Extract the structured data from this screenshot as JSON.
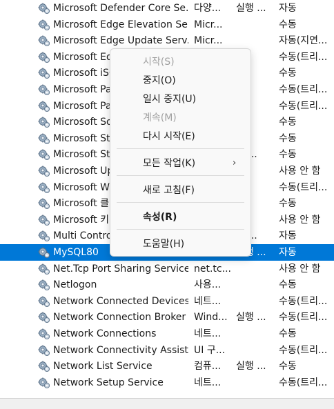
{
  "services": [
    {
      "name": "Microsoft Defender Core Se...",
      "desc": "다양...",
      "status": "실행 ...",
      "start": "자동"
    },
    {
      "name": "Microsoft Edge Elevation Se...",
      "desc": "Micr...",
      "status": "",
      "start": "수동"
    },
    {
      "name": "Microsoft Edge Update Serv...",
      "desc": "Micr...",
      "status": "",
      "start": "자동(지연..."
    },
    {
      "name": "Microsoft Ed",
      "desc": "",
      "status": "",
      "start": "수동(트리..."
    },
    {
      "name": "Microsoft iSC",
      "desc": "",
      "status": "",
      "start": "수동"
    },
    {
      "name": "Microsoft Pa",
      "desc": "",
      "status": "",
      "start": "수동(트리..."
    },
    {
      "name": "Microsoft Pa",
      "desc": "",
      "status": "",
      "start": "수동(트리..."
    },
    {
      "name": "Microsoft So",
      "desc": "",
      "status": "",
      "start": "수동"
    },
    {
      "name": "Microsoft Sto",
      "desc": "",
      "status": "",
      "start": "수동"
    },
    {
      "name": "Microsoft Sto",
      "desc": "",
      "status": "행 ...",
      "start": "수동"
    },
    {
      "name": "Microsoft Up",
      "desc": "",
      "status": "",
      "start": "사용 안 함"
    },
    {
      "name": "Microsoft Wi",
      "desc": "",
      "status": "",
      "start": "수동(트리..."
    },
    {
      "name": "Microsoft 클",
      "desc": "",
      "status": "",
      "start": "수동"
    },
    {
      "name": "Microsoft 키",
      "desc": "",
      "status": "",
      "start": "사용 안 함"
    },
    {
      "name": "Multi Contro",
      "desc": "",
      "status": "행 ...",
      "start": "자동"
    },
    {
      "name": "MySQL80",
      "desc": "",
      "status": "실행 ...",
      "start": "자동",
      "selected": true
    },
    {
      "name": "Net.Tcp Port Sharing Service",
      "desc": "net.tc...",
      "status": "",
      "start": "사용 안 함"
    },
    {
      "name": "Netlogon",
      "desc": "사용...",
      "status": "",
      "start": "수동"
    },
    {
      "name": "Network Connected Devices...",
      "desc": "네트...",
      "status": "",
      "start": "수동(트리..."
    },
    {
      "name": "Network Connection Broker",
      "desc": "Wind...",
      "status": "실행 ...",
      "start": "수동(트리..."
    },
    {
      "name": "Network Connections",
      "desc": "네트...",
      "status": "",
      "start": "수동"
    },
    {
      "name": "Network Connectivity Assist...",
      "desc": "UI 구...",
      "status": "",
      "start": "수동(트리..."
    },
    {
      "name": "Network List Service",
      "desc": "컴퓨...",
      "status": "실행 ...",
      "start": "수동"
    },
    {
      "name": "Network Setup Service",
      "desc": "네트...",
      "status": "",
      "start": "수동(트리..."
    }
  ],
  "context_menu": {
    "start": "시작(S)",
    "stop": "중지(O)",
    "pause": "일시 중지(U)",
    "resume": "계속(M)",
    "restart": "다시 시작(E)",
    "all_tasks": "모든 작업(K)",
    "all_tasks_arrow": "›",
    "refresh": "새로 고침(F)",
    "properties": "속성(R)",
    "help": "도움말(H)"
  },
  "icon": "gear-service-icon",
  "colors": {
    "selection": "#0078d7",
    "menu_bg": "#f9f9f9",
    "disabled_text": "#a0a0a0"
  }
}
